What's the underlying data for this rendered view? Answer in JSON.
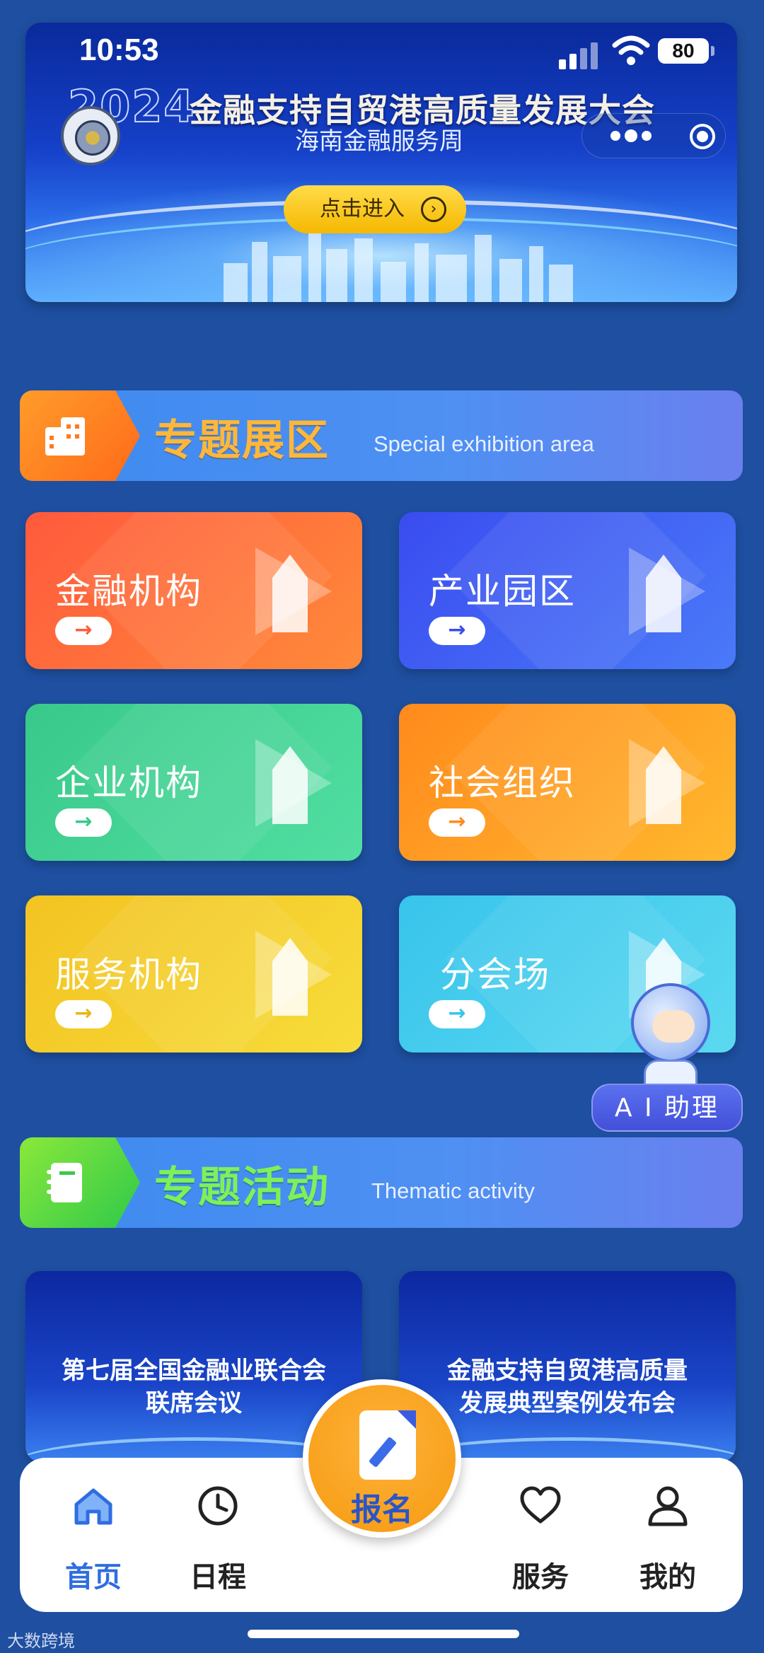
{
  "status_bar": {
    "time": "10:53",
    "battery": "80"
  },
  "banner": {
    "year": "2024",
    "title": "金融支持自贸港高质量发展大会",
    "subtitle": "海南金融服务周",
    "enter_button": "点击进入",
    "enter_icon": "chevron-right-circle-icon"
  },
  "capsule": {
    "more_icon": "more-dots-icon",
    "close_icon": "record-icon"
  },
  "sections": {
    "exhibition": {
      "title": "专题展区",
      "subtitle": "Special exhibition area",
      "icon": "building-icon"
    },
    "activity": {
      "title": "专题活动",
      "subtitle": "Thematic activity",
      "icon": "notebook-icon"
    }
  },
  "cards": [
    {
      "label": "金融机构",
      "arrow": "→",
      "arrow_color": "#ff5a3c"
    },
    {
      "label": "产业园区",
      "arrow": "→",
      "arrow_color": "#3a4cf0"
    },
    {
      "label": "企业机构",
      "arrow": "→",
      "arrow_color": "#38c98a"
    },
    {
      "label": "社会组织",
      "arrow": "→",
      "arrow_color": "#ff8a1c"
    },
    {
      "label": "服务机构",
      "arrow": "→",
      "arrow_color": "#f3c322"
    },
    {
      "label": "分会场",
      "arrow": "→",
      "arrow_color": "#38c4ec"
    }
  ],
  "activities": [
    {
      "line1": "第七届全国金融业联合会",
      "line2": "联席会议"
    },
    {
      "line1": "金融支持自贸港高质量",
      "line2": "发展典型案例发布会"
    }
  ],
  "ai_assistant": {
    "label": "A I 助理"
  },
  "nav": {
    "items": [
      {
        "label": "首页",
        "icon": "home-icon",
        "active": true
      },
      {
        "label": "日程",
        "icon": "clock-icon",
        "active": false
      },
      {
        "label": "服务",
        "icon": "heart-icon",
        "active": false
      },
      {
        "label": "我的",
        "icon": "user-icon",
        "active": false
      }
    ],
    "register": {
      "label": "报名",
      "icon": "edit-document-icon"
    }
  },
  "watermark": "大数跨境",
  "colors": {
    "background": "#1e4fa0",
    "accent": "#2f6de0",
    "section_title_orange": "#ffb73a",
    "section_title_green": "#7ef05a"
  }
}
